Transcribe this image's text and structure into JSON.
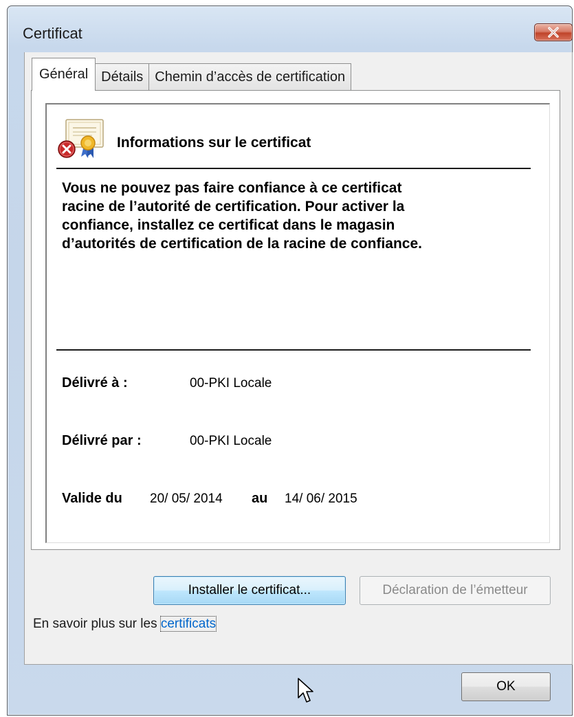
{
  "window": {
    "title": "Certificat",
    "close_glyph": "✕"
  },
  "tabs": [
    {
      "label": "Général",
      "active": true
    },
    {
      "label": "Détails",
      "active": false
    },
    {
      "label": "Chemin d’accès de certification",
      "active": false
    }
  ],
  "certificate": {
    "icon": "certificate-error-icon",
    "heading": "Informations sur le certificat",
    "warning_lines": [
      "Vous ne pouvez pas faire confiance à ce certificat",
      "racine de l’autorité de certification. Pour activer la",
      "confiance, installez ce certificat dans le magasin",
      "d’autorités de certification de la racine de confiance."
    ],
    "issued_to_label": "Délivré à :",
    "issued_to_value": "00-PKI Locale",
    "issued_by_label": "Délivré par :",
    "issued_by_value": "00-PKI Locale",
    "valid_from_label": "Valide du",
    "valid_from_value": "20/ 05/ 2014",
    "valid_to_label": "au",
    "valid_to_value": "14/ 06/ 2015"
  },
  "buttons": {
    "install": "Installer le certificat...",
    "issuer_statement": "Déclaration de l’émetteur",
    "ok": "OK"
  },
  "learn_more": {
    "prefix": "En savoir plus sur les ",
    "link": "certificats"
  },
  "colors": {
    "link": "#0066cc",
    "close_button": "#c0442a",
    "primary_button_border": "#3c7fb1"
  }
}
